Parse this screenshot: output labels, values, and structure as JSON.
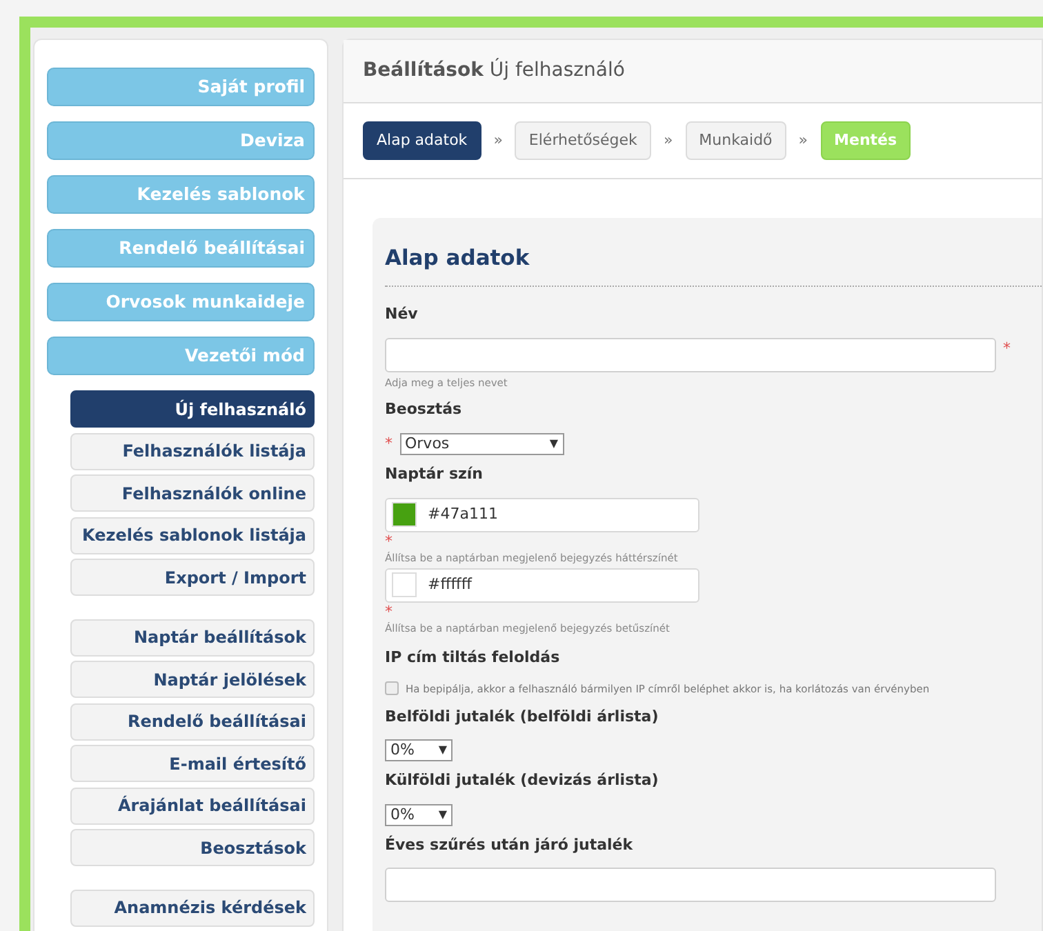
{
  "sidebar": {
    "groups": [
      {
        "kind": "main",
        "items": [
          {
            "label": "Saját profil"
          },
          {
            "label": "Deviza"
          },
          {
            "label": "Kezelés sablonok"
          },
          {
            "label": "Rendelő beállításai"
          },
          {
            "label": "Orvosok munkaideje"
          },
          {
            "label": "Vezetői mód"
          }
        ]
      },
      {
        "kind": "sub",
        "items": [
          {
            "label": "Új felhasználó",
            "selected": true
          },
          {
            "label": "Felhasználók listája",
            "selected": false
          },
          {
            "label": "Felhasználók online",
            "selected": false
          },
          {
            "label": "Kezelés sablonok listája",
            "selected": false
          },
          {
            "label": "Export / Import",
            "selected": false
          }
        ]
      },
      {
        "kind": "sub",
        "items": [
          {
            "label": "Naptár beállítások",
            "selected": false
          },
          {
            "label": "Naptár jelölések",
            "selected": false
          },
          {
            "label": "Rendelő beállításai",
            "selected": false
          },
          {
            "label": "E-mail értesítő",
            "selected": false
          },
          {
            "label": "Árajánlat beállításai",
            "selected": false
          },
          {
            "label": "Beosztások",
            "selected": false
          }
        ]
      },
      {
        "kind": "sub",
        "items": [
          {
            "label": "Anamnézis kérdések",
            "selected": false
          }
        ]
      }
    ]
  },
  "header": {
    "title": "**Beállítások** Új felhasználó"
  },
  "steps": [
    {
      "label": "Alap adatok",
      "kind": "step",
      "selected": true
    },
    {
      "label": "Elérhetőségek",
      "kind": "step",
      "selected": false
    },
    {
      "label": "Munkaidő",
      "kind": "step",
      "selected": false
    },
    {
      "label": "Mentés",
      "kind": "save",
      "selected": false
    }
  ],
  "step_separator": "»",
  "form": {
    "title": "Alap adatok",
    "fields": [
      {
        "kind": "text",
        "label": "Név",
        "required_mark": "*",
        "help": "Adja meg a teljes nevet"
      },
      {
        "kind": "select",
        "label": "Beosztás",
        "required_mark": "*",
        "value": "Orvos",
        "caret": "▼"
      },
      {
        "kind": "colors",
        "label": "Naptár szín",
        "items": [
          {
            "value": "#47a111",
            "color": "#47a111",
            "required_mark": "*",
            "help": "Állítsa be a naptárban megjelenő bejegyzés háttérszínét"
          },
          {
            "value": "#ffffff",
            "color": "#ffffff",
            "required_mark": "*",
            "help": "Állítsa be a naptárban megjelenő bejegyzés betűszínét"
          }
        ]
      },
      {
        "kind": "checkbox",
        "label": "IP cím tiltás feloldás",
        "checked": false,
        "text": "Ha bepipálja, akkor a felhasználó bármilyen IP címről beléphet akkor is, ha korlátozás van érvényben"
      },
      {
        "kind": "small_select",
        "label": "Belföldi jutalék (belföldi árlista)",
        "value": "0%",
        "caret": "▼"
      },
      {
        "kind": "small_select",
        "label": "Külföldi jutalék (devizás árlista)",
        "value": "0%",
        "caret": "▼"
      },
      {
        "kind": "text",
        "label": "Éves szűrés után járó jutalék"
      }
    ]
  }
}
